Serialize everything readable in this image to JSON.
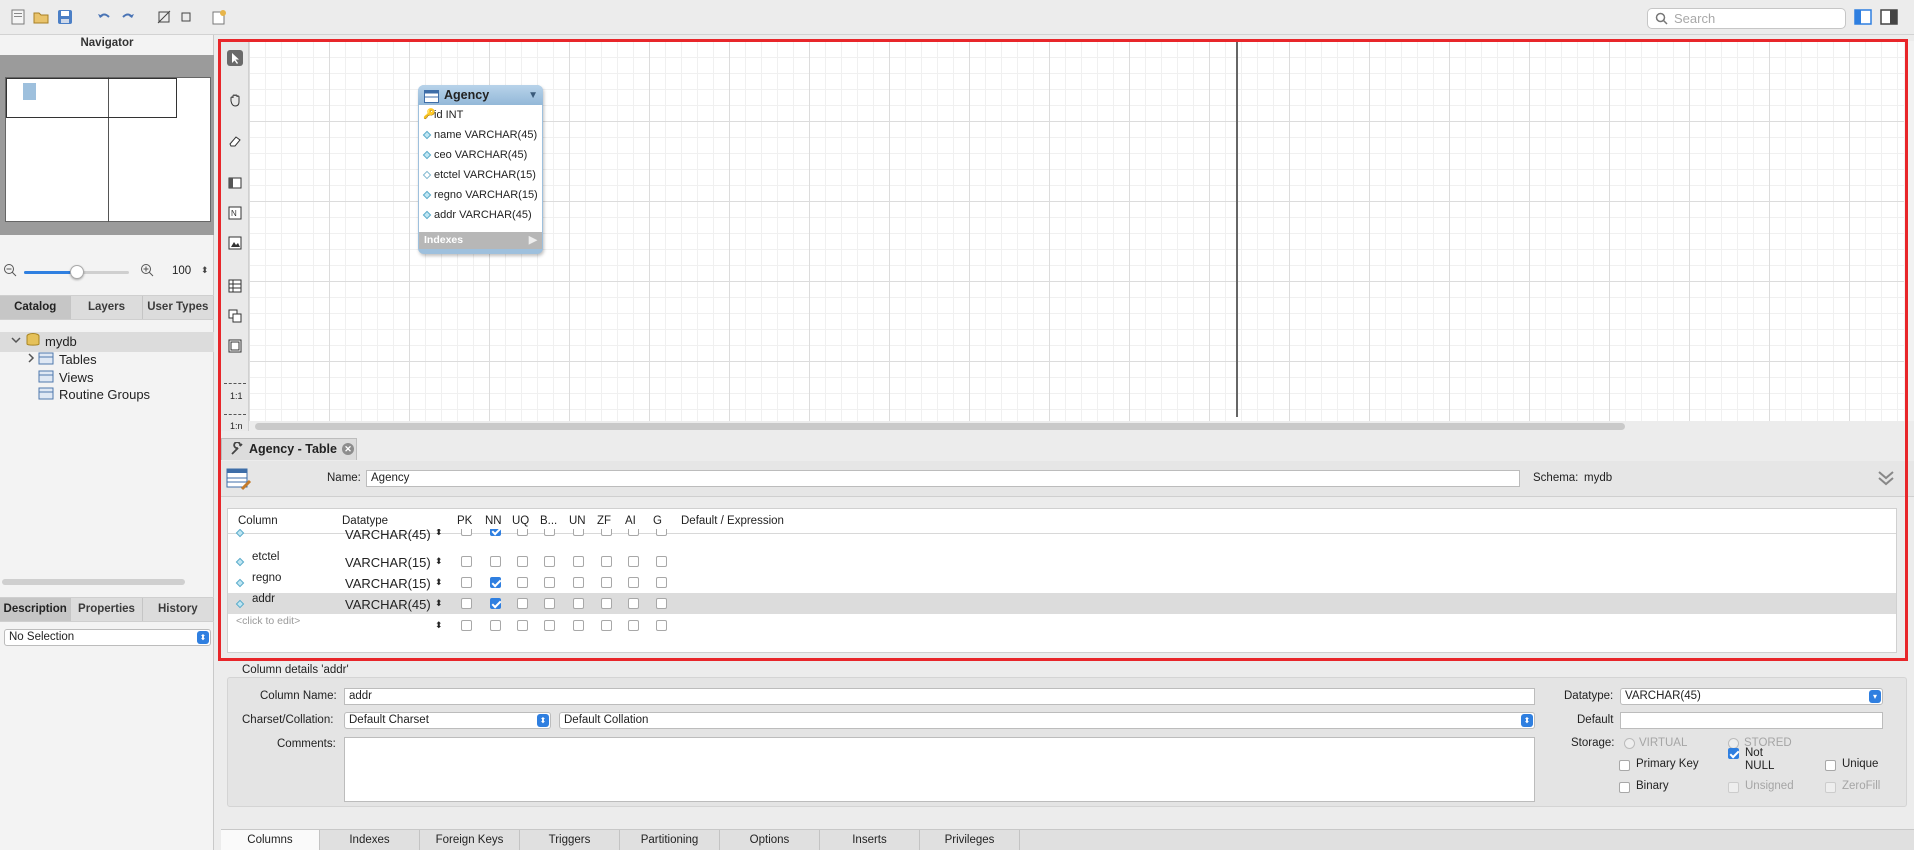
{
  "toolbar": {
    "search_placeholder": "Search"
  },
  "navigator": {
    "title": "Navigator",
    "zoom_value": "100",
    "zoom_slider": 0.5
  },
  "left_tabs": [
    "Catalog",
    "Layers",
    "User Types"
  ],
  "tree": {
    "schema": "mydb",
    "items": [
      "Tables",
      "Views",
      "Routine Groups"
    ]
  },
  "bottom_tabs_left": [
    "Description",
    "Properties",
    "History"
  ],
  "selection": "No Selection",
  "vertical_tools": {
    "rel_11": "1:1",
    "rel_1n": "1:n"
  },
  "entity": {
    "title": "Agency",
    "columns": [
      "id INT",
      "name VARCHAR(45)",
      "ceo VARCHAR(45)",
      "etctel VARCHAR(15)",
      "regno VARCHAR(15)",
      "addr VARCHAR(45)"
    ],
    "indexes_label": "Indexes"
  },
  "editor": {
    "tab_title": "Agency - Table",
    "name_label": "Name:",
    "name_value": "Agency",
    "schema_label": "Schema:",
    "schema_value": "mydb"
  },
  "columns_grid": {
    "headers": [
      "Column",
      "Datatype",
      "PK",
      "NN",
      "UQ",
      "B...",
      "UN",
      "ZF",
      "AI",
      "G",
      "Default / Expression"
    ],
    "rows": [
      {
        "name": "",
        "type": "VARCHAR(45)",
        "flags": [
          false,
          true,
          false,
          false,
          false,
          false,
          false,
          false
        ]
      },
      {
        "name": "etctel",
        "type": "VARCHAR(15)",
        "flags": [
          false,
          false,
          false,
          false,
          false,
          false,
          false,
          false
        ]
      },
      {
        "name": "regno",
        "type": "VARCHAR(15)",
        "flags": [
          false,
          true,
          false,
          false,
          false,
          false,
          false,
          false
        ]
      },
      {
        "name": "addr",
        "type": "VARCHAR(45)",
        "flags": [
          false,
          true,
          false,
          false,
          false,
          false,
          false,
          false
        ]
      },
      {
        "name": "<click to edit>",
        "type": "",
        "flags": [
          false,
          false,
          false,
          false,
          false,
          false,
          false,
          false
        ]
      }
    ]
  },
  "details": {
    "title": "Column details 'addr'",
    "column_name_label": "Column Name:",
    "column_name": "addr",
    "charset_label": "Charset/Collation:",
    "charset": "Default Charset",
    "collation": "Default Collation",
    "comments_label": "Comments:",
    "datatype_label": "Datatype:",
    "datatype": "VARCHAR(45)",
    "default_label": "Default",
    "storage_label": "Storage:",
    "virtual": "VIRTUAL",
    "stored": "STORED",
    "primary_key": "Primary Key",
    "not_null": "Not NULL",
    "unique": "Unique",
    "binary": "Binary",
    "unsigned": "Unsigned",
    "zerofill": "ZeroFill"
  },
  "bottom_tabs": [
    "Columns",
    "Indexes",
    "Foreign Keys",
    "Triggers",
    "Partitioning",
    "Options",
    "Inserts",
    "Privileges"
  ],
  "colors": {
    "accent": "#2f7fe0",
    "highlight": "#e8262a",
    "entity_header": "#9ec0dd"
  }
}
